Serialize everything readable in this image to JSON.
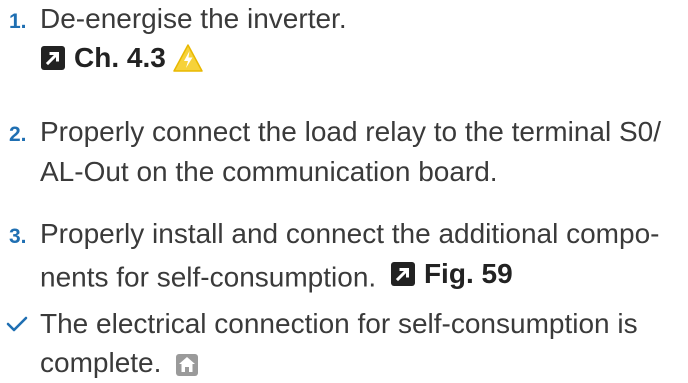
{
  "steps": [
    {
      "num": "1.",
      "lines": [
        "De-energise the inverter."
      ],
      "ref": "Ch. 4.3"
    },
    {
      "num": "2.",
      "lines": [
        "Properly connect the load relay to the terminal S0/",
        "AL-Out on the communication board."
      ]
    },
    {
      "num": "3.",
      "lines": [
        "Properly install and connect the additional compo-",
        "nents for self-consumption."
      ],
      "ref": "Fig. 59"
    }
  ],
  "result": {
    "lines": [
      "The electrical connection for self-consumption is",
      "complete."
    ]
  },
  "icons": {
    "link": "arrow-link-icon",
    "warning": "electrical-warning-icon",
    "check": "checkmark-icon",
    "home": "home-icon"
  },
  "colors": {
    "step_number": "#1f6fb2",
    "warning_fill": "#f6d23a",
    "text": "#3a3a3a"
  }
}
